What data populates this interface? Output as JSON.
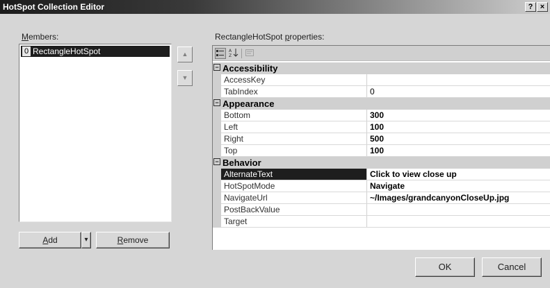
{
  "window": {
    "title": "HotSpot Collection Editor",
    "help_button": "?",
    "close_button": "×"
  },
  "members": {
    "label_prefix": "",
    "label_access": "M",
    "label_rest": "embers:",
    "items": [
      {
        "index": "0",
        "name": "RectangleHotSpot"
      }
    ],
    "move_up": "▲",
    "move_down": "▼"
  },
  "buttons": {
    "add_access": "A",
    "add_rest": "dd",
    "add_dropdown": "▾",
    "remove_access": "R",
    "remove_rest": "emove",
    "ok": "OK",
    "cancel": "Cancel"
  },
  "properties": {
    "label_prefix": "RectangleHotSpot ",
    "label_access": "p",
    "label_rest": "roperties:",
    "toolbar": {
      "categorized_icon": "categorized-icon",
      "alphabetical_icon": "alphabetical-icon",
      "property_pages_icon": "property-pages-icon"
    },
    "categories": [
      {
        "name": "Accessibility",
        "expander": "⊟",
        "rows": [
          {
            "name": "AccessKey",
            "value": "",
            "bold": false
          },
          {
            "name": "TabIndex",
            "value": "0",
            "bold": false
          }
        ]
      },
      {
        "name": "Appearance",
        "expander": "⊟",
        "rows": [
          {
            "name": "Bottom",
            "value": "300",
            "bold": true
          },
          {
            "name": "Left",
            "value": "100",
            "bold": true
          },
          {
            "name": "Right",
            "value": "500",
            "bold": true
          },
          {
            "name": "Top",
            "value": "100",
            "bold": true
          }
        ]
      },
      {
        "name": "Behavior",
        "expander": "⊟",
        "rows": [
          {
            "name": "AlternateText",
            "value": "Click to view close up",
            "bold": true,
            "selected": true
          },
          {
            "name": "HotSpotMode",
            "value": "Navigate",
            "bold": true
          },
          {
            "name": "NavigateUrl",
            "value": "~/Images/grandcanyonCloseUp.jpg",
            "bold": true
          },
          {
            "name": "PostBackValue",
            "value": "",
            "bold": false
          },
          {
            "name": "Target",
            "value": "",
            "bold": false
          }
        ]
      }
    ]
  }
}
